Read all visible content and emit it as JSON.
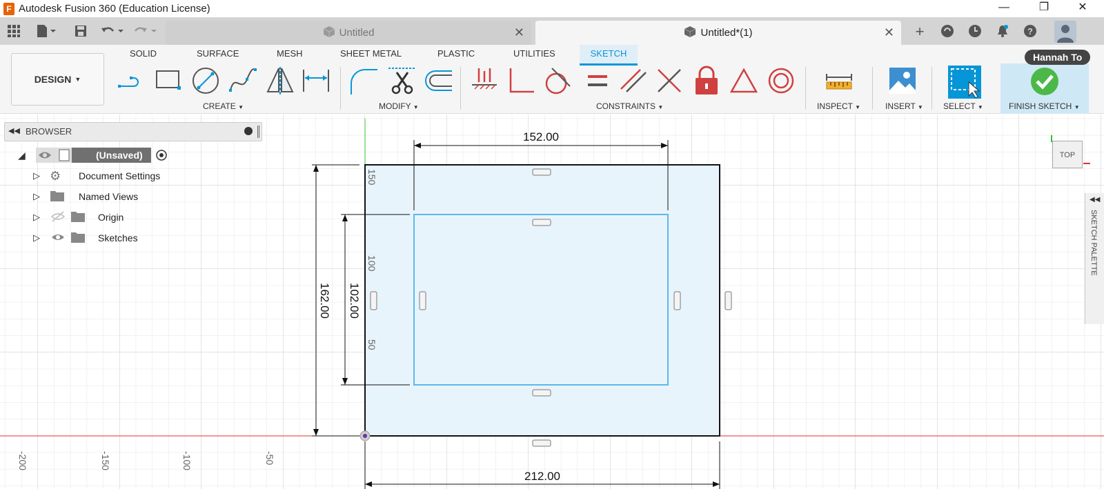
{
  "window": {
    "title": "Autodesk Fusion 360 (Education License)",
    "logo": "F",
    "minimize": "—",
    "restore": "❐",
    "close": "✕"
  },
  "tabs": [
    {
      "label": "Untitled",
      "active": false
    },
    {
      "label": "Untitled*(1)",
      "active": true
    }
  ],
  "ribbon": {
    "workspace": "DESIGN",
    "tabs": [
      "SOLID",
      "SURFACE",
      "MESH",
      "SHEET METAL",
      "PLASTIC",
      "UTILITIES",
      "SKETCH"
    ],
    "active_tab": "SKETCH",
    "groups": [
      "CREATE",
      "MODIFY",
      "CONSTRAINTS",
      "INSPECT",
      "INSERT",
      "SELECT",
      "FINISH SKETCH"
    ]
  },
  "user": {
    "name": "Hannah To"
  },
  "browser": {
    "title": "BROWSER",
    "root": "(Unsaved)",
    "nodes": [
      "Document Settings",
      "Named Views",
      "Origin",
      "Sketches"
    ]
  },
  "viewcube": {
    "face": "TOP"
  },
  "sketch_palette": {
    "label": "SKETCH PALETTE"
  },
  "dimensions": {
    "top_width": "152.00",
    "bottom_width": "212.00",
    "outer_height": "162.00",
    "inner_height": "102.00"
  },
  "axis_labels": {
    "x": [
      "-200",
      "-150",
      "-100",
      "-50"
    ],
    "y": [
      "150",
      "100",
      "50"
    ]
  },
  "colors": {
    "accent": "#0696d7",
    "finish_green": "#4cb848",
    "x_axis": "#e03030",
    "y_axis": "#30c030",
    "inner_rect": "#5cb8e8",
    "profile_fill": "#e8f4fb"
  }
}
